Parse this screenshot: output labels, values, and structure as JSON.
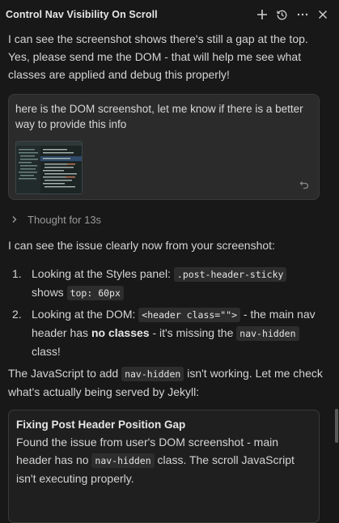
{
  "header": {
    "title": "Control Nav Visibility On Scroll",
    "icons": [
      "plus-icon",
      "history-icon",
      "more-icon",
      "close-icon"
    ]
  },
  "chat": {
    "assistant_intro": "I can see the screenshot shows there's still a gap at the top. Yes, please send me the DOM - that will help me see what classes are applied and debug this properly!",
    "user_message": "here is the DOM screenshot, let me know if there is a better way to provide this info",
    "thought_label": "Thought for 13s",
    "issue_intro": "I can see the issue clearly now from your screenshot:",
    "list": [
      {
        "num": "1.",
        "text1": "Looking at the Styles panel: ",
        "code1": ".post-header-sticky",
        "text2": " shows ",
        "code2": "top: 60px"
      },
      {
        "num": "2.",
        "text1": "Looking at the DOM: ",
        "code1": "<header class=\"\">",
        "text2": " - the main nav header has ",
        "bold": "no classes",
        "text3": " - it's missing the ",
        "code2": "nav-hidden",
        "text4": " class!"
      }
    ],
    "js_para": {
      "text1": "The JavaScript to add ",
      "code": "nav-hidden",
      "text2": " isn't working. Let me check what's actually being served by Jekyll:"
    },
    "card": {
      "title": "Fixing Post Header Position Gap",
      "text1": "Found the issue from user's DOM screenshot - main header has no ",
      "code": "nav-hidden",
      "text2": " class. The scroll JavaScript isn't executing properly."
    }
  }
}
